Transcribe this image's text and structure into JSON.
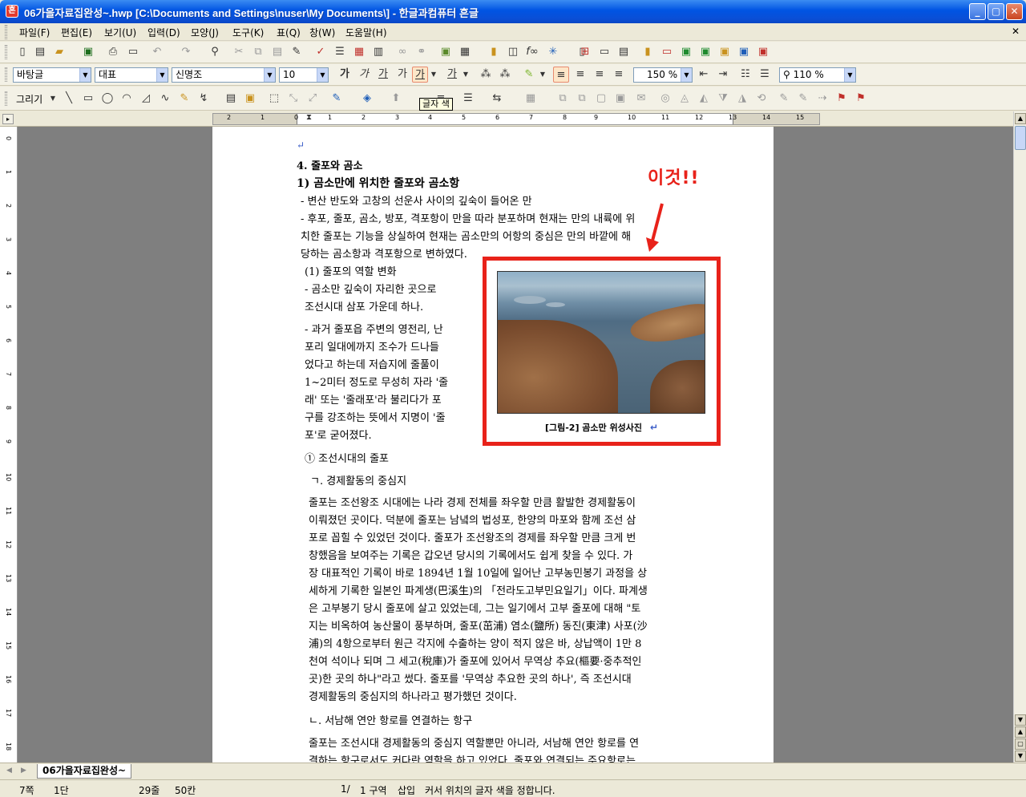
{
  "window": {
    "title": "06가을자료집완성~.hwp [C:\\Documents and Settings\\nuser\\My Documents\\] - 한글과컴퓨터 흔글"
  },
  "menu": [
    "파일(F)",
    "편집(E)",
    "보기(U)",
    "입력(D)",
    "모양(J)",
    "도구(K)",
    "표(Q)",
    "창(W)",
    "도움말(H)"
  ],
  "format_toolbar": {
    "style": "바탕글",
    "font_lang": "대표",
    "font": "신명조",
    "size": "10",
    "line_spacing": "150 %",
    "zoom": "110 %",
    "b": "가",
    "i": "가",
    "u": "가",
    "color_a": "가",
    "color_b": "가"
  },
  "draw_toolbar": {
    "label": "그리기"
  },
  "tooltip": "글자 색",
  "ruler_numbers": [
    "2",
    "1",
    "0",
    "1",
    "2",
    "3",
    "4",
    "5",
    "6",
    "7",
    "8",
    "9",
    "10",
    "11",
    "12",
    "13",
    "14",
    "15"
  ],
  "vruler_numbers": [
    "0",
    "1",
    "2",
    "3",
    "4",
    "5",
    "6",
    "7",
    "8",
    "9",
    "10",
    "11",
    "12",
    "13",
    "14",
    "15",
    "16",
    "17",
    "18"
  ],
  "annotation": {
    "text": "이것!!"
  },
  "figure": {
    "caption": "[그림-2] 곰소만 위성사진"
  },
  "doc": {
    "h1": "4. 줄포와 곰소",
    "h2": "1) 곰소만에 위치한 줄포와 곰소항",
    "p1": "- 변산 반도와 고창의 선운사 사이의 깊숙이 들어온 만",
    "p2a": "- 후포, 줄포, 곰소, 방포, 격포항이 만을 따라 분포하며 현재는 만의 내륙에 위",
    "p2b": "치한 줄포는 기능을 상실하여 현재는 곰소만의 어항의 중심은 만의 바깥에 해",
    "p2c": "당하는 곰소항과 격포항으로 변하였다.",
    "p3": "(1) 줄포의 역할 변화",
    "p4a": "- 곰소만 깊숙이 자리한 곳으로",
    "p4b": "조선시대 삼포 가운데 하나.",
    "p5a": "- 과거 줄포읍 주변의 영전리, 난",
    "p5b": "포리 일대에까지 조수가 드나들",
    "p5c": "었다고 하는데 저습지에 줄풀이",
    "p5d": "1~2미터 정도로 무성히 자라 '줄",
    "p5e": "래' 또는 '줄래포'라 불리다가 포",
    "p5f": "구를 강조하는 뜻에서 지명이 '줄",
    "p5g": "포'로 굳어졌다.",
    "p6": "① 조선시대의 줄포",
    "p7": "ㄱ. 경제활동의 중심지",
    "p8a": "줄포는 조선왕조 시대에는 나라 경제 전체를 좌우할 만큼 활발한 경제활동이",
    "p8b": "이뤄졌던 곳이다. 덕분에 줄포는 남녘의 법성포, 한양의 마포와 함께 조선 삼",
    "p8c": "포로 꼽힐 수 있었던 것이다. 줄포가 조선왕조의 경제를 좌우할 만큼 크게 번",
    "p8d": "창했음을 보여주는 기록은 갑오년 당시의 기록에서도 쉽게 찾을 수 있다. 가",
    "p8e": "장 대표적인 기록이 바로 1894년 1월 10일에 일어난 고부농민봉기 과정을 상",
    "p8f": "세하게 기록한 일본인 파계생(巴溪生)의 「전라도고부민요일기」이다. 파계생",
    "p8g": "은 고부봉기 당시 줄포에 살고 있었는데, 그는 일기에서 고부 줄포에 대해 \"토",
    "p8h": "지는 비옥하여 농산물이 풍부하며, 줄포(茁浦) 염소(鹽所) 동진(東津) 사포(沙",
    "p8i": "浦)의 4항으로부터 원근 각지에 수출하는 양이 적지 않은 바, 상납액이 1만 8",
    "p8j": "천여 석이나 되며 그 세고(稅庫)가 줄포에 있어서 무역상 추요(樞要·중추적인",
    "p8k": "곳)한 곳의 하나\"라고 썼다. 줄포를 '무역상 추요한 곳의 하나', 즉 조선시대",
    "p8l": "경제활동의 중심지의 하나라고 평가했던 것이다.",
    "p9": "ㄴ. 서남해 연안 항로를 연결하는 항구",
    "p10a": "줄포는 조선시대 경제활동의 중심지 역할뿐만 아니라, 서남해 연안 항로를 연",
    "p10b": "결하는 항구로서도 커다란 역할을 하고 있었다. 줄포와 연결되는 주요항로는"
  },
  "tab": {
    "label": "06가을자료집완성~"
  },
  "status": {
    "page": "7쪽",
    "column": "1단",
    "line": "29줄",
    "col": "50칸",
    "pos": "1/",
    "section": "1 구역",
    "mode": "삽입",
    "message": "커서 위치의 글자 색을 정합니다."
  },
  "colors": {
    "annotation": "#e8221a",
    "title_bar": "#0054e3",
    "return_mark": "#3a5cc8"
  }
}
